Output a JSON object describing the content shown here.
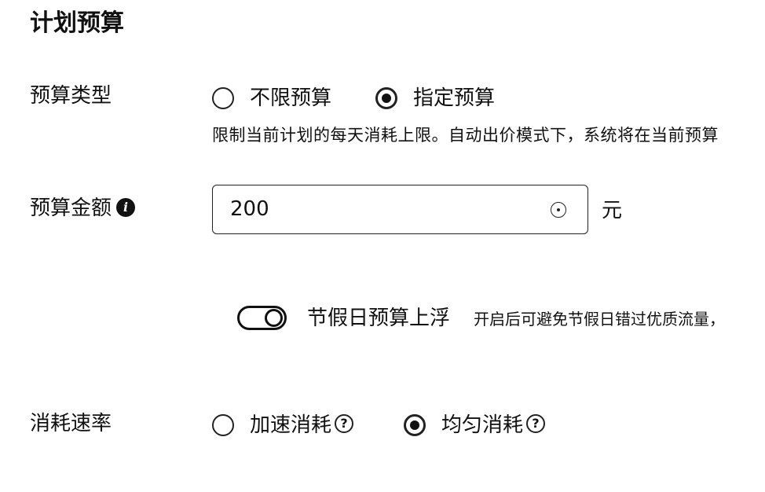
{
  "section": {
    "title": "计划预算"
  },
  "budget_type": {
    "label": "预算类型",
    "options": [
      {
        "label": "不限预算",
        "selected": false
      },
      {
        "label": "指定预算",
        "selected": true
      }
    ],
    "hint": "限制当前计划的每天消耗上限。自动出价模式下，系统将在当前预算"
  },
  "budget_amount": {
    "label": "预算金额",
    "value": "200",
    "unit": "元"
  },
  "holiday_float": {
    "label": "节假日预算上浮",
    "description": "开启后可避免节假日错过优质流量，",
    "enabled": true
  },
  "pace": {
    "label": "消耗速率",
    "options": [
      {
        "label": "加速消耗",
        "selected": false
      },
      {
        "label": "均匀消耗",
        "selected": true
      }
    ]
  },
  "icons": {
    "info": "info-icon",
    "help": "question-icon",
    "clear": "clear-icon"
  }
}
